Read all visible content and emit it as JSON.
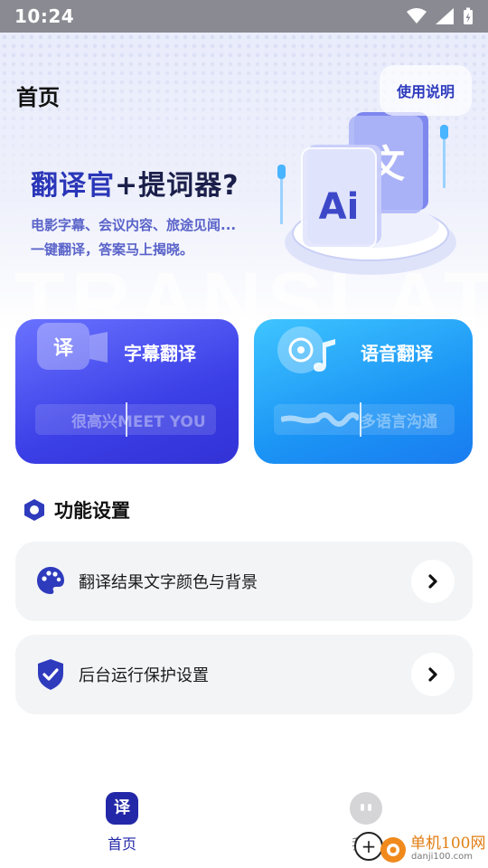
{
  "status": {
    "time": "10:24"
  },
  "header": {
    "title": "首页",
    "help_label": "使用说明"
  },
  "hero": {
    "headline_part1": "翻译官",
    "headline_part2": "+提词器?",
    "line1": "电影字幕、会议内容、旅途见闻...",
    "line2": "一键翻译，答案马上揭晓。",
    "watermark": "TRANSLATE",
    "ai_label": "Ai",
    "wen_char": "文"
  },
  "cards": [
    {
      "title": "字幕翻译",
      "icon_char": "译",
      "strip_text": "很高兴MEET YOU",
      "accent": "#3b3fe6"
    },
    {
      "title": "语音翻译",
      "strip_text": "多语言沟通",
      "accent": "#1b94f5"
    }
  ],
  "section": {
    "title": "功能设置"
  },
  "settings": [
    {
      "label": "翻译结果文字颜色与背景",
      "icon": "palette-icon"
    },
    {
      "label": "后台运行保护设置",
      "icon": "shield-check-icon"
    }
  ],
  "nav": {
    "home_label": "首页",
    "home_icon_char": "译",
    "mine_label": "我的"
  },
  "watermark_badge": {
    "name": "单机100网",
    "url": "danji100.com"
  },
  "colors": {
    "primary": "#2e3bbd",
    "blue": "#1b94f5"
  }
}
